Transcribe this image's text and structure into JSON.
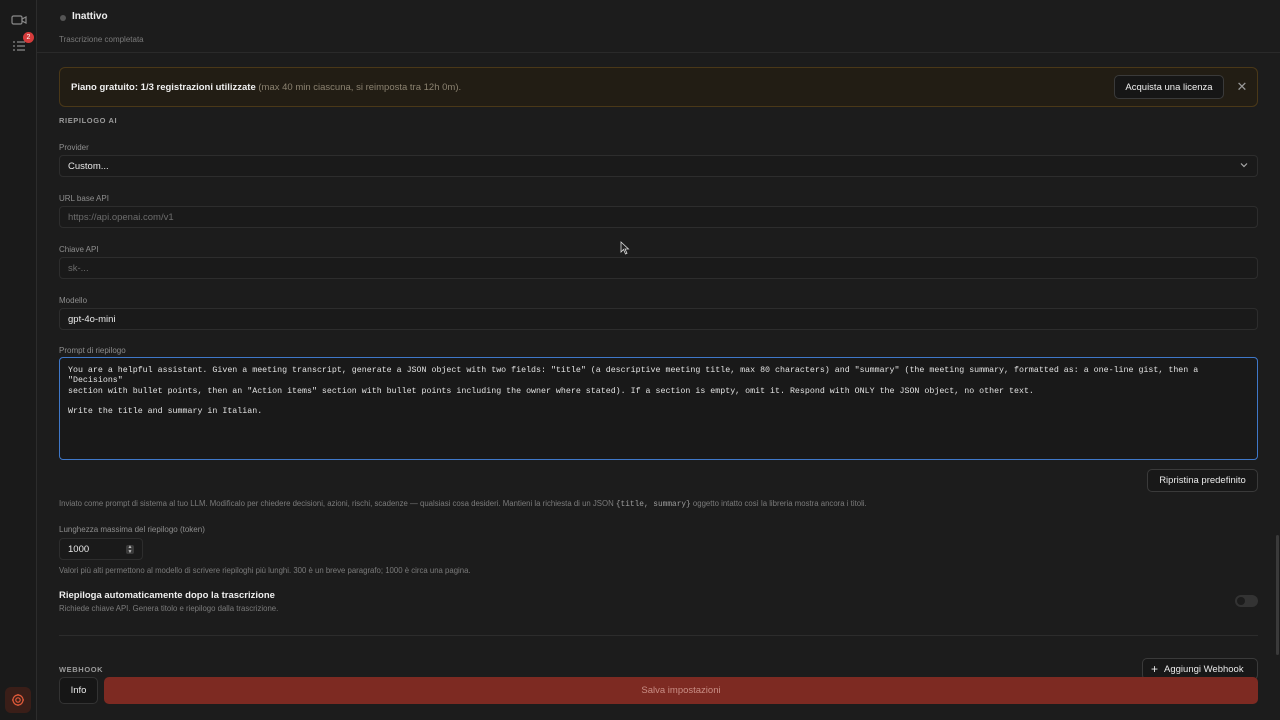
{
  "rail": {
    "badge_count": "2"
  },
  "status": {
    "label": "Inattivo",
    "subtitle": "Trascrizione completata"
  },
  "banner": {
    "strong_text": "Piano gratuito: 1/3 registrazioni utilizzate",
    "muted_text": " (max 40 min ciascuna, si reimposta tra 12h 0m).",
    "buy_label": "Acquista una licenza",
    "close_symbol": "✕"
  },
  "ai_summary": {
    "section_title": "RIEPILOGO AI",
    "provider_label": "Provider",
    "provider_value": "Custom...",
    "base_url_label": "URL base API",
    "base_url_placeholder": "https://api.openai.com/v1",
    "api_key_label": "Chiave API",
    "api_key_placeholder": "sk-...",
    "model_label": "Modello",
    "model_value": "gpt-4o-mini",
    "prompt_label": "Prompt di riepilogo",
    "prompt_value": "You are a helpful assistant. Given a meeting transcript, generate a JSON object with two fields: \"title\" (a descriptive meeting title, max 80 characters) and \"summary\" (the meeting summary, formatted as: a one-line gist, then a \"Decisions\"\nsection with bullet points, then an \"Action items\" section with bullet points including the owner where stated). If a section is empty, omit it. Respond with ONLY the JSON object, no other text.\n\nWrite the title and summary in Italian.",
    "reset_label": "Ripristina predefinito",
    "prompt_help_1": "Inviato come prompt di sistema al tuo LLM. Modificalo per chiedere decisioni, azioni, rischi, scadenze — qualsiasi cosa desideri. Mantieni la richiesta di un JSON ",
    "prompt_help_code": "{title, summary}",
    "prompt_help_2": " oggetto intatto così la libreria mostra ancora i titoli.",
    "max_tokens_label": "Lunghezza massima del riepilogo (token)",
    "max_tokens_value": "1000",
    "max_tokens_help": "Valori più alti permettono al modello di scrivere riepiloghi più lunghi. 300 è un breve paragrafo; 1000 è circa una pagina.",
    "auto_title": "Riepiloga automaticamente dopo la trascrizione",
    "auto_help": "Richiede chiave API. Genera titolo e riepilogo dalla trascrizione.",
    "auto_enabled": false
  },
  "webhook": {
    "section_title": "WEBHOOK",
    "add_label": "Aggiungi Webhook"
  },
  "footer": {
    "info_label": "Info",
    "save_label": "Salva impostazioni"
  },
  "colors": {
    "accent_blue": "#3f78c9",
    "save_red": "#7d2a22",
    "badge_red": "#d53b3b"
  }
}
